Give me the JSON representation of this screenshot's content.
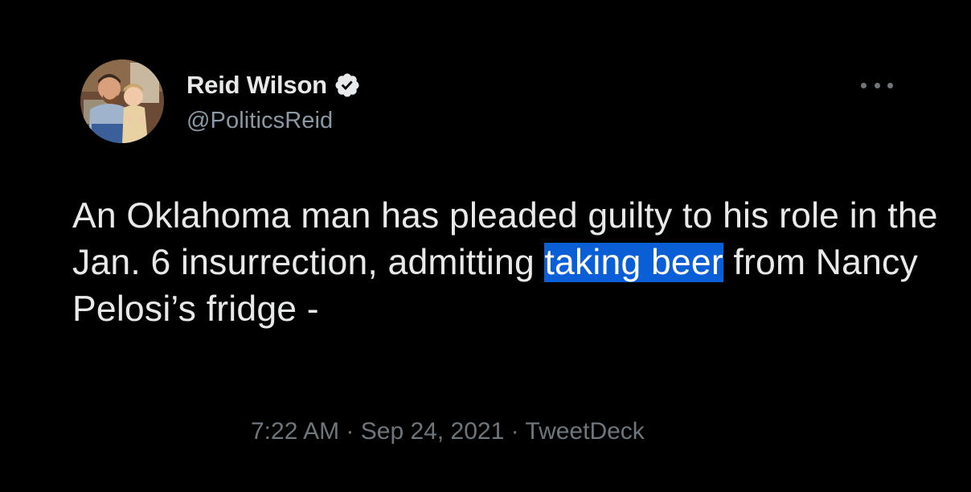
{
  "author": {
    "display_name": "Reid Wilson",
    "handle": "@PoliticsReid",
    "verified": true,
    "avatar_icon": "profile-photo"
  },
  "tweet": {
    "text_before": "An Oklahoma man has pleaded guilty to his role in the Jan. 6 insurrection, admitting ",
    "text_highlighted": "taking beer",
    "text_after": " from Nancy Pelosi’s fridge -"
  },
  "meta": {
    "time": "7:22 AM",
    "separator": "·",
    "date": "Sep 24, 2021",
    "source": "TweetDeck"
  },
  "icons": {
    "more": "more-options-icon",
    "verified": "verified-badge-icon"
  },
  "colors": {
    "background": "#000000",
    "primary_text": "#e7e9ea",
    "secondary_text": "#8b98a5",
    "highlight": "#0a5fd6"
  }
}
